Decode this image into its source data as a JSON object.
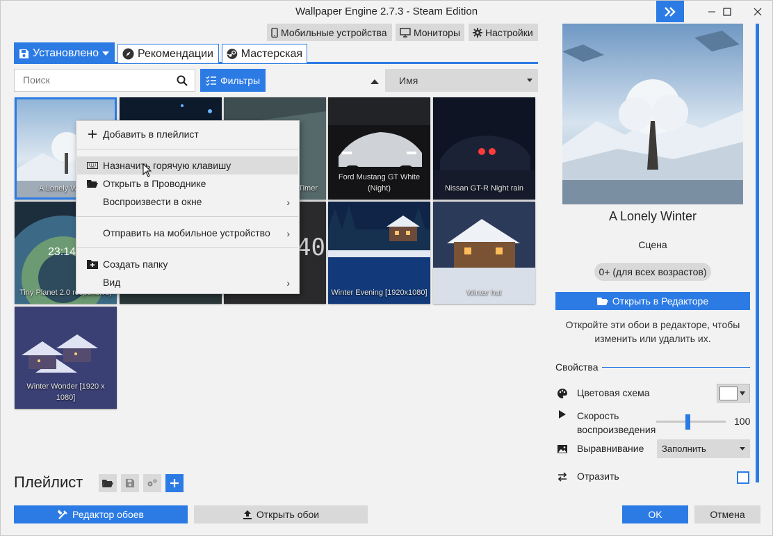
{
  "window": {
    "title": "Wallpaper Engine 2.7.3 - Steam Edition"
  },
  "topbar": {
    "mobile": "Мобильные устройства",
    "monitors": "Мониторы",
    "settings": "Настройки"
  },
  "tabs": [
    {
      "label": "Установлено",
      "active": true,
      "icon": "save-icon"
    },
    {
      "label": "Рекомендации",
      "active": false,
      "icon": "compass-icon"
    },
    {
      "label": "Мастерская",
      "active": false,
      "icon": "steam-icon"
    }
  ],
  "search": {
    "placeholder": "Поиск",
    "value": ""
  },
  "filters_label": "Фильтры",
  "sort": {
    "selected": "Имя"
  },
  "wallpapers": [
    {
      "title": "A Lonely Winter",
      "selected": true
    },
    {
      "title": "",
      "selected": false
    },
    {
      "title": "Timer",
      "selected": false
    },
    {
      "title": "Ford Mustang GT White (Night)",
      "selected": false
    },
    {
      "title": "Nissan GT-R Night rain",
      "selected": false
    },
    {
      "title": "Tiny Planet 2.0 responsive)",
      "selected": false
    },
    {
      "title": "",
      "selected": false
    },
    {
      "title": "",
      "selected": false
    },
    {
      "title": "Winter Evening [1920x1080]",
      "selected": false
    },
    {
      "title": "Winter hut",
      "selected": false
    },
    {
      "title": "Winter Wonder [1920 x 1080]",
      "selected": false
    }
  ],
  "tile_extras": {
    "clock": "23:14",
    "digital": "40"
  },
  "context_menu": {
    "add_playlist": "Добавить в плейлист",
    "hotkey": "Назначить горячую клавишу",
    "explorer": "Открыть в Проводнике",
    "play_window": "Воспроизвести в окне",
    "send_mobile": "Отправить на мобильное устройство",
    "create_folder": "Создать папку",
    "view": "Вид"
  },
  "details": {
    "title": "A Lonely Winter",
    "type": "Сцена",
    "rating": "0+ (для всех возрастов)",
    "open_editor": "Открыть в Редакторе",
    "editor_hint": "Откройте эти обои в редакторе, чтобы изменить или удалить их."
  },
  "properties": {
    "heading": "Свойства",
    "color_scheme": "Цветовая схема",
    "color_value": "#ffffff",
    "speed_label": "Скорость воспроизведения",
    "speed_value": "100",
    "speed_fraction": 0.45,
    "alignment_label": "Выравнивание",
    "alignment_value": "Заполнить",
    "mirror_label": "Отразить",
    "mirror_checked": false
  },
  "playlist": {
    "title": "Плейлист"
  },
  "bottom": {
    "editor": "Редактор обоев",
    "open": "Открыть обои",
    "ok": "OK",
    "cancel": "Отмена"
  },
  "colors": {
    "accent": "#2c7be5",
    "button_gray": "#d9d9d9",
    "background": "#f2f2f2"
  }
}
